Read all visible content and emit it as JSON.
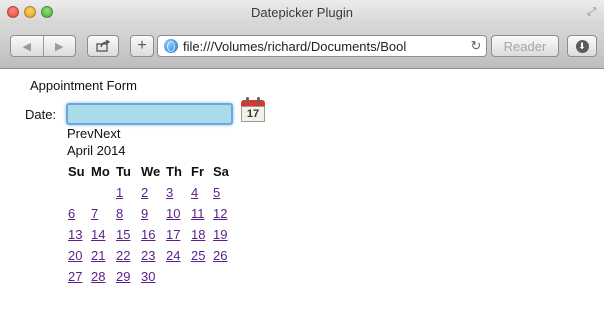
{
  "window": {
    "title": "Datepicker Plugin"
  },
  "toolbar": {
    "back_icon": "back-arrow-icon",
    "forward_icon": "forward-arrow-icon",
    "share_icon": "share-icon",
    "new_tab_label": "+",
    "url": "file:///Volumes/richard/Documents/Bool",
    "reload_icon": "reload-icon",
    "reader_label": "Reader",
    "downloads_icon": "downloads-icon"
  },
  "form": {
    "title": "Appointment Form",
    "date_label": "Date:",
    "date_value": "",
    "calendar_icon_day": "17"
  },
  "datepicker": {
    "prev_label": "Prev",
    "next_label": "Next",
    "month_label": "April 2014",
    "weekdays": [
      "Su",
      "Mo",
      "Tu",
      "We",
      "Th",
      "Fr",
      "Sa"
    ],
    "weeks": [
      [
        "",
        "",
        "1",
        "2",
        "3",
        "4",
        "5"
      ],
      [
        "6",
        "7",
        "8",
        "9",
        "10",
        "11",
        "12"
      ],
      [
        "13",
        "14",
        "15",
        "16",
        "17",
        "18",
        "19"
      ],
      [
        "20",
        "21",
        "22",
        "23",
        "24",
        "25",
        "26"
      ],
      [
        "27",
        "28",
        "29",
        "30",
        "",
        "",
        ""
      ]
    ]
  },
  "colors": {
    "input_fill": "#a9dbe8",
    "input_focus_ring": "#6aa8e0",
    "link_visited": "#5a1f8a"
  }
}
